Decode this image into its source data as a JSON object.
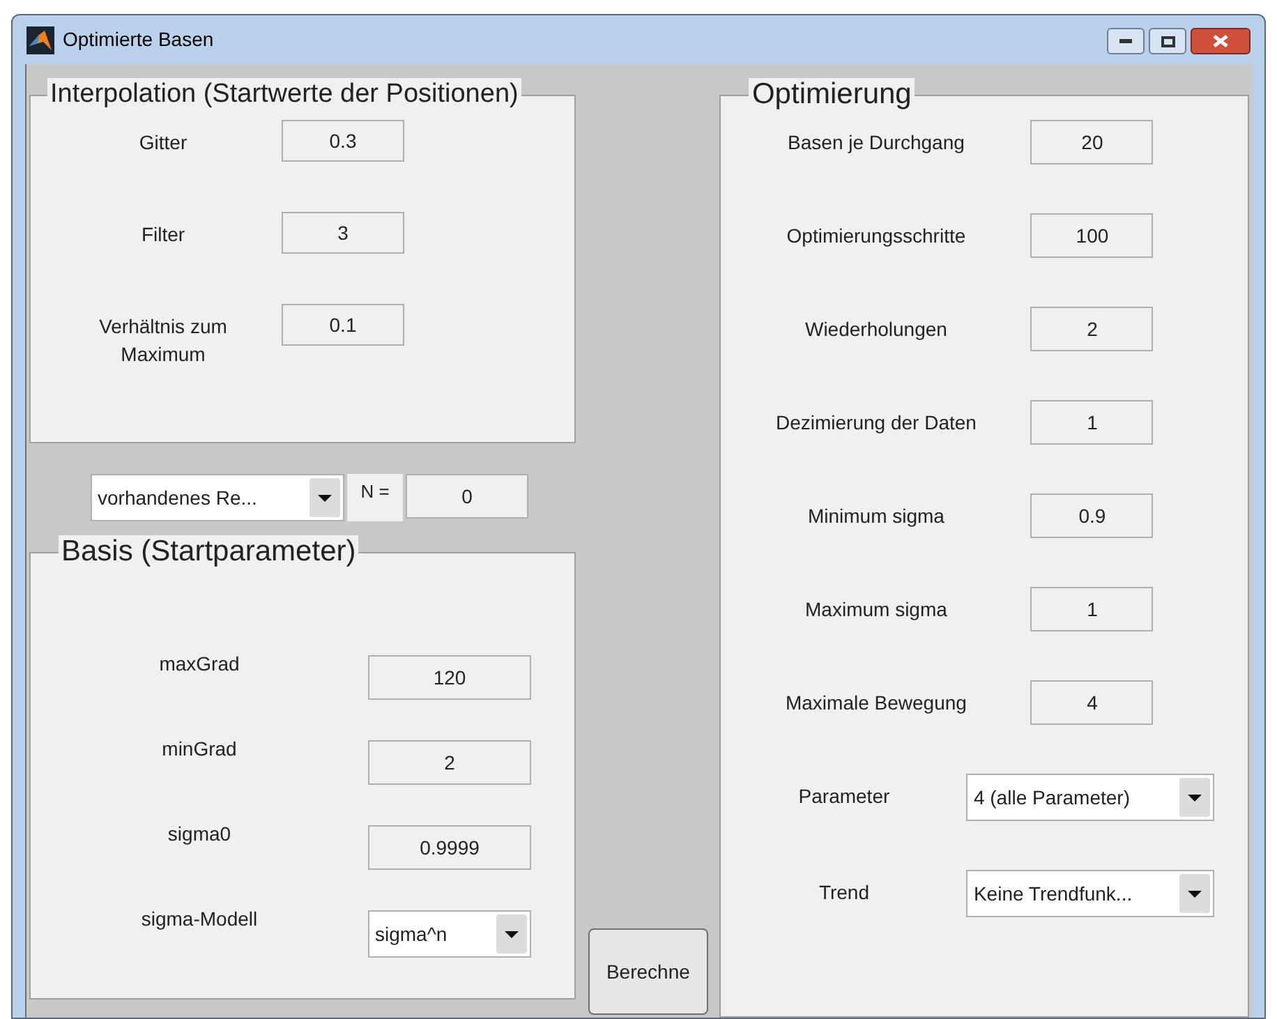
{
  "window": {
    "title": "Optimierte Basen"
  },
  "interpolation": {
    "title": "Interpolation (Startwerte der Positionen)",
    "fields": [
      {
        "kind": "field",
        "label": "Gitter",
        "value": "0.3"
      },
      {
        "kind": "field",
        "label": "Filter",
        "value": "3"
      },
      {
        "kind": "field",
        "label": "Verhältnis zum Maximum",
        "value": "0.1"
      }
    ]
  },
  "source": {
    "dropdown": "vorhandenes Re...",
    "n_label": "N =",
    "n_value": "0"
  },
  "basis": {
    "title": "Basis (Startparameter)",
    "fields": [
      {
        "kind": "field",
        "label": "maxGrad",
        "value": "120"
      },
      {
        "kind": "field",
        "label": "minGrad",
        "value": "2"
      },
      {
        "kind": "field",
        "label": "sigma0",
        "value": "0.9999"
      },
      {
        "kind": "dropdown",
        "label": "sigma-Modell",
        "value": "sigma^n"
      }
    ]
  },
  "compute_button": "Berechne",
  "optimization": {
    "title": "Optimierung",
    "fields": [
      {
        "kind": "field",
        "label": "Basen je Durchgang",
        "value": "20"
      },
      {
        "kind": "field",
        "label": "Optimierungsschritte",
        "value": "100"
      },
      {
        "kind": "field",
        "label": "Wiederholungen",
        "value": "2"
      },
      {
        "kind": "field",
        "label": "Dezimierung der Daten",
        "value": "1"
      },
      {
        "kind": "field",
        "label": "Minimum sigma",
        "value": "0.9"
      },
      {
        "kind": "field",
        "label": "Maximum sigma",
        "value": "1"
      },
      {
        "kind": "field",
        "label": "Maximale Bewegung",
        "value": "4"
      },
      {
        "kind": "dropdown",
        "label": "Parameter",
        "value": "4 (alle Parameter)"
      },
      {
        "kind": "dropdown",
        "label": "Trend",
        "value": "Keine Trendfunk..."
      }
    ]
  }
}
